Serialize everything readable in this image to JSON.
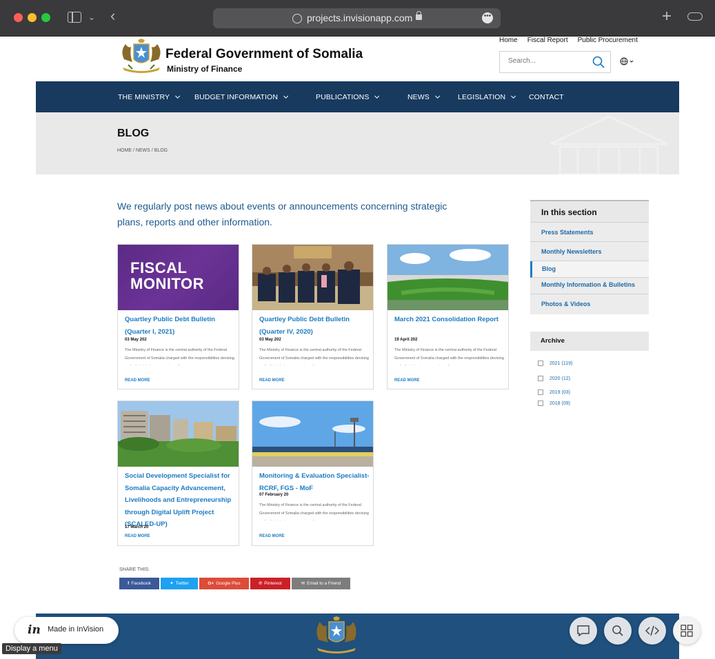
{
  "browser": {
    "url": "projects.invisionapp.com"
  },
  "header": {
    "title": "Federal Government of Somalia",
    "subtitle": "Ministry of Finance",
    "top_links": [
      "Home",
      "Fiscal Report",
      "Public Procurement"
    ],
    "search_placeholder": "Search..."
  },
  "nav": {
    "items": [
      {
        "label": "THE MINISTRY",
        "dropdown": true
      },
      {
        "label": "BUDGET INFORMATION",
        "dropdown": true
      },
      {
        "label": "PUBLICATIONS",
        "dropdown": true
      },
      {
        "label": "NEWS",
        "dropdown": true
      },
      {
        "label": "LEGISLATION",
        "dropdown": true
      },
      {
        "label": "CONTACT",
        "dropdown": false
      }
    ]
  },
  "banner": {
    "title": "BLOG",
    "breadcrumb": "HOME / NEWS / BLOG"
  },
  "intro": "We regularly post news about events or announcements concerning strategic plans, reports and other information.",
  "posts": [
    {
      "image_label": "FISCAL\nMONITOR",
      "title": "Quartley Public Debt Bulletin (Quarter I, 2021)",
      "date": "03 May 202",
      "excerpt": "The Ministry of Finance is the central authority of the Federal Government of Somalia charged with the responsibilities devising and administering economic and",
      "read_more": "READ MORE"
    },
    {
      "title": "Quartley Public Debt Bulletin (Quarter IV, 2020)",
      "date": "03 May 202",
      "excerpt": "The Ministry of Finance is the central authority of the Federal Government of Somalia charged with the responsibilities devising and administering economic and",
      "read_more": "READ MORE"
    },
    {
      "title": "March 2021 Consolidation Report",
      "date": "19 April 202",
      "excerpt": "The Ministry of Finance is the central authority of the Federal Government of Somalia charged with the responsibilities devising and administering economic and",
      "read_more": "READ MORE"
    },
    {
      "title": "Social Development Specialist for Somalia Capacity Advancement, Livelihoods and Entrepreneurship through Digital Uplift Project (SCALED-UP)",
      "date": "17 March 20",
      "read_more": "READ MORE"
    },
    {
      "title": "Monitoring & Evaluation Specialist-RCRF, FGS - MoF",
      "date": "07 February 20",
      "excerpt": "The Ministry of Finance is the central authority of the Federal Government of Somalia charged with the responsibilities devising and administering economic and",
      "read_more": "READ MORE"
    }
  ],
  "sidebar": {
    "heading": "In this section",
    "items": [
      {
        "label": "Press Statements",
        "active": false
      },
      {
        "label": "Monthly Newsletters",
        "active": false
      },
      {
        "label": "Blog",
        "active": true
      },
      {
        "label": "Monthly Information & Bulletins",
        "active": false
      },
      {
        "label": "Photos & Videos",
        "active": false
      }
    ],
    "archive_heading": "Archive",
    "archive": [
      "2021 (119)",
      "2020 (12)",
      "2019 (03)",
      "2018 (09)"
    ]
  },
  "share": {
    "label": "SHARE THIS:",
    "buttons": [
      {
        "label": "Facebook",
        "icon": "f",
        "color": "#3b5998"
      },
      {
        "label": "Twitter",
        "icon": "twitter-bird-icon",
        "color": "#1da1f2"
      },
      {
        "label": "Google Plus",
        "icon": "G+",
        "color": "#dd4b39"
      },
      {
        "label": "Pinterest",
        "icon": "pinterest-icon",
        "color": "#cb2027"
      },
      {
        "label": "Email to a Friend",
        "icon": "email-icon",
        "color": "#7d7d7d"
      }
    ]
  },
  "invision": {
    "logo": "in",
    "badge": "Made in InVision",
    "tooltip": "Display a menu"
  },
  "colors": {
    "nav_bg": "#173a5e",
    "link_blue": "#1e7bc2",
    "footer_bg": "#20507e"
  }
}
